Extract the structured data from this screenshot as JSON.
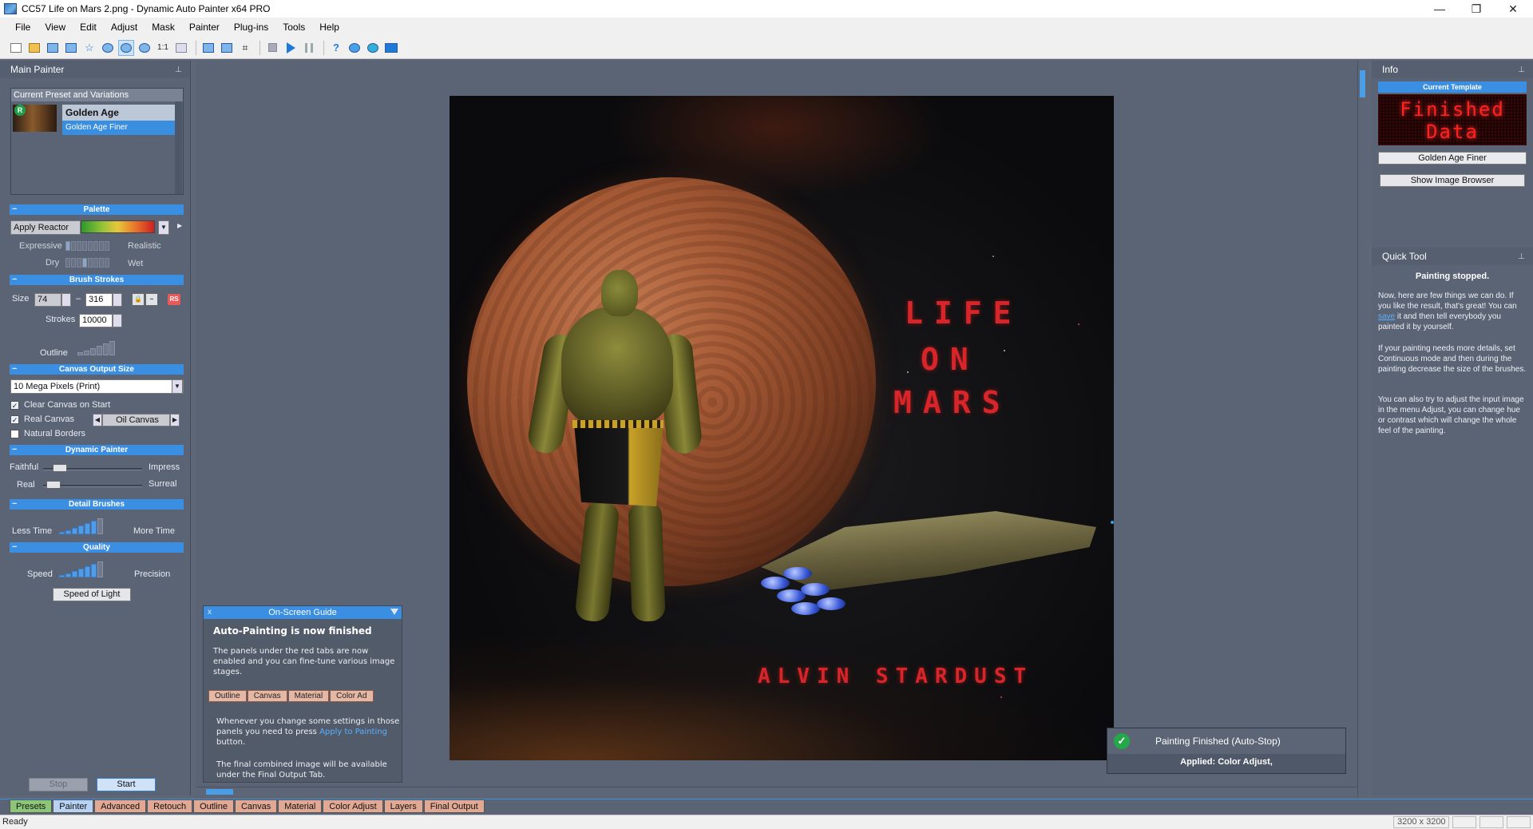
{
  "window": {
    "title": "CC57 Life on Mars 2.png - Dynamic Auto Painter x64 PRO",
    "controls": [
      "—",
      "❐",
      "✕"
    ]
  },
  "menu": [
    "File",
    "View",
    "Edit",
    "Adjust",
    "Mask",
    "Painter",
    "Plug-ins",
    "Tools",
    "Help"
  ],
  "toolbar": {
    "buttons": [
      "new-icon",
      "open-icon",
      "save-icon",
      "save-as-icon",
      "star-icon",
      "fit-icon",
      "zoom-in-icon",
      "zoom-out-icon",
      "actual-size-icon",
      "fullscreen-icon",
      "compare-icon",
      "split-icon",
      "crop-icon",
      "stop-icon",
      "play-icon",
      "pause-icon",
      "help-icon",
      "layers-icon",
      "export-icon",
      "frame-icon"
    ],
    "actual_size_label": "1:1"
  },
  "left_panel": {
    "title": "Main Painter",
    "preset_box_title": "Current Preset and Variations",
    "preset_badge": "R",
    "preset_name": "Golden Age",
    "preset_variation": "Golden Age Finer",
    "palette": {
      "section": "Palette",
      "apply_label": "Apply Reactor",
      "expressive": "Expressive",
      "realistic": "Realistic",
      "dry": "Dry",
      "wet": "Wet"
    },
    "brush": {
      "section": "Brush Strokes",
      "size_label": "Size",
      "size_min": "74",
      "size_sep": "–",
      "size_max": "316",
      "strokes_label": "Strokes",
      "strokes_value": "10000",
      "outline_label": "Outline",
      "rs_label": "RS"
    },
    "canvas_output": {
      "section": "Canvas Output Size",
      "value": "10 Mega Pixels (Print)",
      "clear_canvas": "Clear Canvas on Start",
      "real_canvas": "Real Canvas",
      "canvas_type": "Oil Canvas",
      "natural_borders": "Natural Borders"
    },
    "dynamic_painter": {
      "section": "Dynamic Painter",
      "faithful": "Faithful",
      "impress": "Impress",
      "real": "Real",
      "surreal": "Surreal"
    },
    "detail_brushes": {
      "section": "Detail Brushes",
      "less_time": "Less Time",
      "more_time": "More Time"
    },
    "quality": {
      "section": "Quality",
      "speed": "Speed",
      "precision": "Precision",
      "preset_button": "Speed of Light"
    },
    "stop_button": "Stop",
    "start_button": "Start"
  },
  "painting": {
    "title_line1": "LIFE",
    "title_line2": "ON",
    "title_line3": "MARS",
    "artist": "ALVIN STARDUST"
  },
  "guide": {
    "header": "On-Screen Guide",
    "close": "x",
    "title": "Auto-Painting is now finished",
    "text1": "The panels under the red tabs are now enabled and you can fine-tune various image stages.",
    "tabs": [
      "Outline",
      "Canvas",
      "Material",
      "Color Ad"
    ],
    "text2a": "Whenever you change some settings in those panels you need to press",
    "text2_link": "Apply to Painting",
    "text2b": "button.",
    "text3": "The final combined image will be available under the Final Output Tab."
  },
  "right_panel": {
    "info_title": "Info",
    "template_head": "Current Template",
    "led_line1": "Finished",
    "led_line2": "Data",
    "template_name": "Golden Age Finer",
    "show_browser": "Show Image Browser",
    "quick_tool_title": "Quick Tool",
    "status_title": "Painting stopped.",
    "p1a": "Now, here are few things we can do. If you like the result, that's great! You can",
    "p1_link": "save",
    "p1b": "it and then tell everybody you painted it by yourself.",
    "p2": "If your painting needs more details, set Continuous mode and then during the painting decrease the size of the brushes.",
    "p3": "You can also try to adjust the input image in the menu Adjust, you can change hue or contrast which will change the whole feel of the painting."
  },
  "notification": {
    "title": "Painting Finished (Auto-Stop)",
    "applied": "Applied:  Color Adjust,"
  },
  "bottom_tabs": [
    {
      "label": "Presets",
      "kind": "green"
    },
    {
      "label": "Painter",
      "kind": "blue"
    },
    {
      "label": "Advanced",
      "kind": "red"
    },
    {
      "label": "Retouch",
      "kind": "red"
    },
    {
      "label": "Outline",
      "kind": "red"
    },
    {
      "label": "Canvas",
      "kind": "red"
    },
    {
      "label": "Material",
      "kind": "red"
    },
    {
      "label": "Color Adjust",
      "kind": "red"
    },
    {
      "label": "Layers",
      "kind": "red"
    },
    {
      "label": "Final Output",
      "kind": "red"
    }
  ],
  "status": {
    "text": "Ready",
    "dimensions": "3200 x 3200"
  },
  "colors": {
    "accent": "#3b8fe2",
    "panel": "#5a6475",
    "led_red": "#ff2020",
    "tab_red": "#e1a894",
    "tab_green": "#8cc676"
  }
}
